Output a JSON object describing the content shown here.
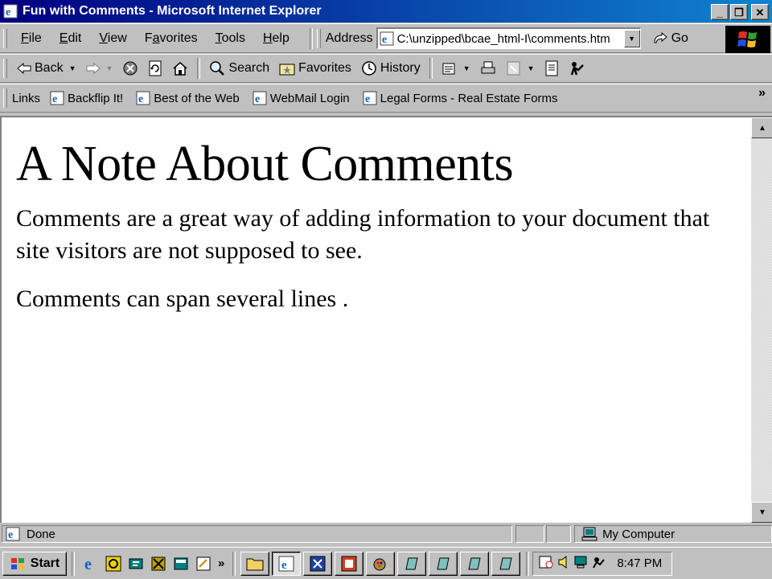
{
  "window": {
    "title": "Fun with Comments - Microsoft Internet Explorer",
    "caption_buttons": {
      "minimize": "_",
      "maximize": "❐",
      "close": "✕"
    }
  },
  "menu": {
    "items": [
      {
        "label": "File",
        "accel": "F"
      },
      {
        "label": "Edit",
        "accel": "E"
      },
      {
        "label": "View",
        "accel": "V"
      },
      {
        "label": "Favorites",
        "accel": "a"
      },
      {
        "label": "Tools",
        "accel": "T"
      },
      {
        "label": "Help",
        "accel": "H"
      }
    ]
  },
  "address": {
    "label": "Address",
    "value": "C:\\unzipped\\bcae_html-I\\comments.htm",
    "go_label": "Go"
  },
  "toolbar": {
    "back_label": "Back",
    "search_label": "Search",
    "favorites_label": "Favorites",
    "history_label": "History"
  },
  "links": {
    "label": "Links",
    "items": [
      "Backflip It!",
      "Best of the Web",
      "WebMail Login",
      "Legal Forms - Real Estate Forms"
    ],
    "overflow": "»"
  },
  "page": {
    "heading": "A Note About Comments",
    "paragraphs": [
      "Comments are a great way of adding information to your document that site visitors are not supposed to see.",
      "Comments can span several lines ."
    ]
  },
  "status": {
    "text": "Done",
    "zone": "My Computer"
  },
  "taskbar": {
    "start_label": "Start",
    "quicklaunch_overflow": "»",
    "clock": "8:47 PM"
  },
  "colors": {
    "titlebar_start": "#000080",
    "titlebar_end": "#1084d0",
    "chrome": "#c0c0c0",
    "page_background": "#ffffff"
  },
  "icons": [
    "ie-icon",
    "back-arrow-icon",
    "forward-arrow-icon",
    "stop-icon",
    "refresh-icon",
    "home-icon",
    "search-icon",
    "favorites-icon",
    "history-icon",
    "mail-icon",
    "print-icon",
    "edit-icon",
    "discuss-icon",
    "messenger-icon",
    "windows-logo-icon",
    "computer-icon",
    "speaker-icon",
    "clock"
  ]
}
